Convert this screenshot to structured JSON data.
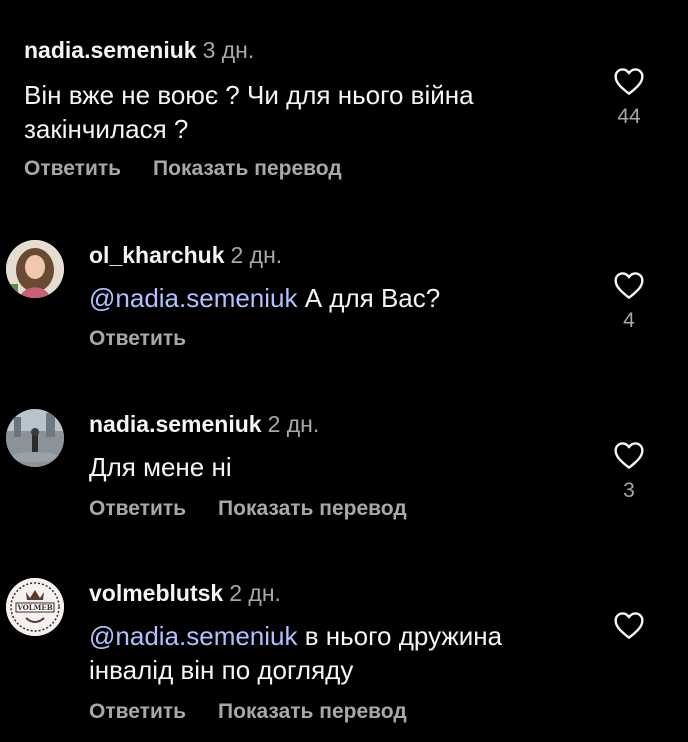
{
  "comments": [
    {
      "username": "nadia.semeniuk",
      "time": "3 дн.",
      "mention": "",
      "text": "Він вже не воює ? Чи для нього війна закінчилася ?",
      "actions": [
        "Ответить",
        "Показать перевод"
      ],
      "likes": "44",
      "avatar_icon": "none"
    },
    {
      "username": "ol_kharchuk",
      "time": "2 дн.",
      "mention": "@nadia.semeniuk",
      "text": " А для Вас?",
      "actions": [
        "Ответить"
      ],
      "likes": "4",
      "avatar_icon": "profile-photo"
    },
    {
      "username": "nadia.semeniuk",
      "time": "2 дн.",
      "mention": "",
      "text": "Для мене ні",
      "actions": [
        "Ответить",
        "Показать перевод"
      ],
      "likes": "3",
      "avatar_icon": "profile-photo"
    },
    {
      "username": "volmeblutsk",
      "time": "2 дн.",
      "mention": "@nadia.semeniuk",
      "text": " в нього дружина інвалід він по догляду",
      "actions": [
        "Ответить",
        "Показать перевод"
      ],
      "likes": "",
      "avatar_icon": "logo"
    }
  ],
  "avatar_logo_text": "VOLMEB",
  "colors": {
    "background": "#000000",
    "primary_text": "#f5f5f5",
    "secondary_text": "#a8a8a8",
    "mention": "#b3bfff"
  }
}
